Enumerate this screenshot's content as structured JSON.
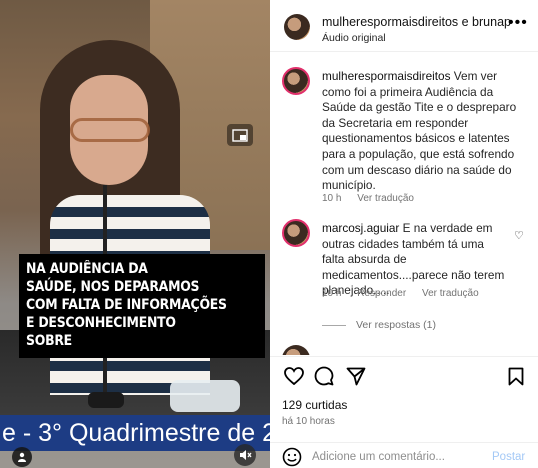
{
  "video": {
    "caption_lines": [
      "NA AUDIÊNCIA DA",
      "SAÚDE, NOS DEPARAMOS",
      "COM FALTA DE INFORMAÇÕES",
      "E DESCONHECIMENTO",
      "SOBRE"
    ],
    "banner_text": "e - 3° Quadrimestre de 2",
    "banner_color": "#1d3c84"
  },
  "header": {
    "username": "mulherespormaisdireitos e brunap",
    "subtitle": "Áudio original",
    "more_icon": "more-horizontal-icon"
  },
  "comments": [
    {
      "username": "mulherespormaisdireitos",
      "text": "Vem ver como foi a primeira Audiência da Saúde da gestão Tite e o despreparo da Secretaria em responder questionamentos básicos e latentes para a população, que está sofrendo com um descaso diário na saúde do município.",
      "time": "10 h",
      "translate": "Ver tradução"
    },
    {
      "username": "marcosj.aguiar",
      "text": "E na verdade em outras cidades também tá uma falta absurda de medicamentos....parece não terem planejado.....",
      "time": "10 h",
      "reply": "Responder",
      "translate": "Ver tradução",
      "view_replies": "Ver respostas (1)"
    }
  ],
  "actions": {
    "likes": "129 curtidas",
    "time": "há 10 horas",
    "icons": [
      "heart-icon",
      "comment-icon",
      "share-icon",
      "bookmark-icon"
    ]
  },
  "add_comment": {
    "placeholder": "Adicione um comentário...",
    "post_label": "Postar"
  },
  "colors": {
    "accent_blue": "#0095f6",
    "muted_text": "#737373",
    "story_ring": "#e1306c"
  }
}
